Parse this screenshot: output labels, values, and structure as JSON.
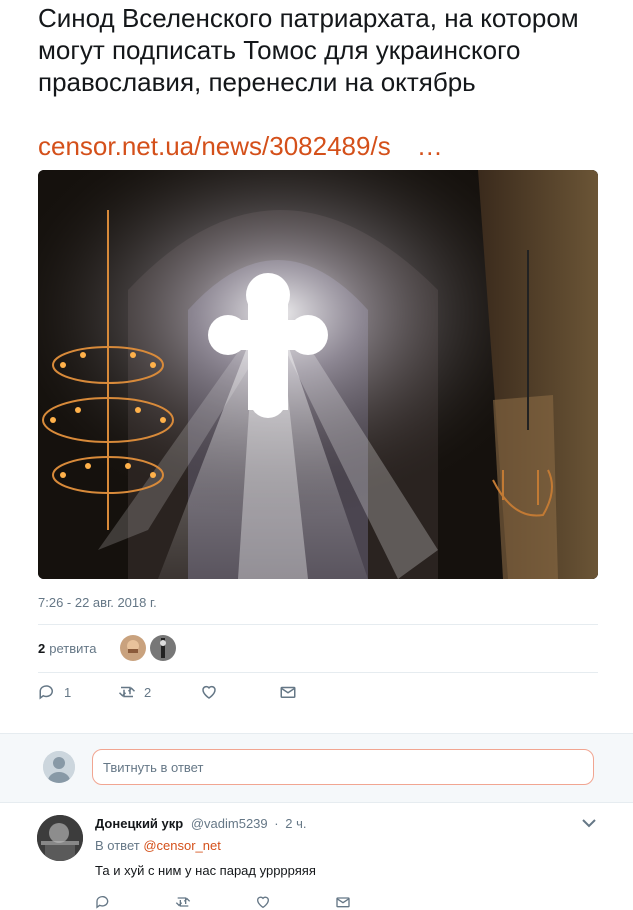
{
  "tweet": {
    "text": "Синод Вселенского патриархата, на котором могут подписать Томос для украинского православия, перенесли на октябрь",
    "link_text": "censor.net.ua/news/3082489/s",
    "link_ellipsis": "…",
    "timestamp": "7:26 - 22 авг. 2018 г.",
    "retweets_count": "2",
    "retweets_label": "ретвита",
    "actions": {
      "reply_count": "1",
      "retweet_count": "2",
      "like_count": "",
      "message_count": ""
    }
  },
  "reply_box": {
    "placeholder": "Твитнуть в ответ"
  },
  "reply": {
    "name": "Донецкий укр",
    "handle": "@vadim5239",
    "separator": "·",
    "time": "2 ч.",
    "reply_to_prefix": "В ответ",
    "reply_to_mention": "@censor_net",
    "text": "Та и хуй с ним у нас парад урррряяя"
  },
  "colors": {
    "accent": "#d4501a",
    "muted": "#657786",
    "divider": "#e6ecf0"
  },
  "icons": [
    "reply-icon",
    "retweet-icon",
    "like-icon",
    "message-icon",
    "chevron-down-icon"
  ]
}
